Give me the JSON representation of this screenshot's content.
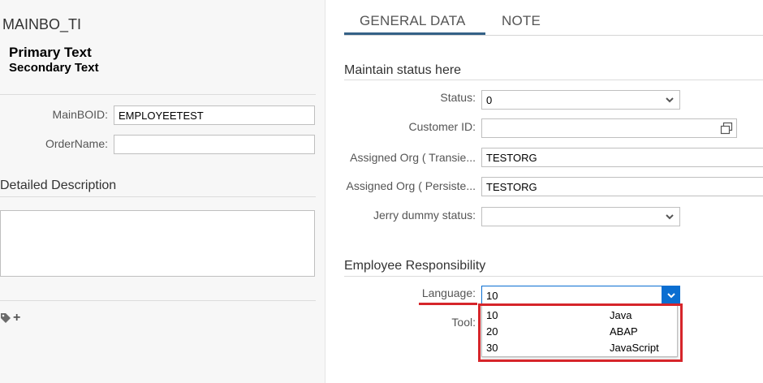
{
  "header": {
    "object_title": "MAINBO_TI",
    "primary_text": "Primary Text",
    "secondary_text": "Secondary Text"
  },
  "form_left": {
    "main_boid_label": "MainBOID:",
    "main_boid_value": "EMPLOYEETEST",
    "order_name_label": "OrderName:",
    "order_name_value": ""
  },
  "description": {
    "title": "Detailed Description"
  },
  "tabs": [
    {
      "label": "GENERAL DATA",
      "active": true
    },
    {
      "label": "NOTE",
      "active": false
    }
  ],
  "status_section": {
    "title": "Maintain status here",
    "status_label": "Status:",
    "status_value": "0",
    "customer_id_label": "Customer ID:",
    "customer_id_value": "",
    "assigned_org_transient_label": "Assigned Org ( Transie...",
    "assigned_org_transient_value": "TESTORG",
    "assigned_org_persistent_label": "Assigned Org ( Persiste...",
    "assigned_org_persistent_value": "TESTORG",
    "jerry_dummy_label": "Jerry dummy status:",
    "jerry_dummy_value": ""
  },
  "employee_section": {
    "title": "Employee Responsibility",
    "language_label": "Language:",
    "language_value": "10",
    "tool_label": "Tool:",
    "language_options": [
      {
        "key": "10",
        "text": "Java"
      },
      {
        "key": "20",
        "text": "ABAP"
      },
      {
        "key": "30",
        "text": "JavaScript"
      }
    ]
  },
  "colors": {
    "accent": "#0a6ed1",
    "tab_active_underline": "#346187",
    "highlight_red": "#d6252a"
  },
  "icons": {
    "tag": "tag-icon",
    "add": "plus-icon",
    "chevron": "chevron-down-icon",
    "value_help": "value-help-icon"
  }
}
